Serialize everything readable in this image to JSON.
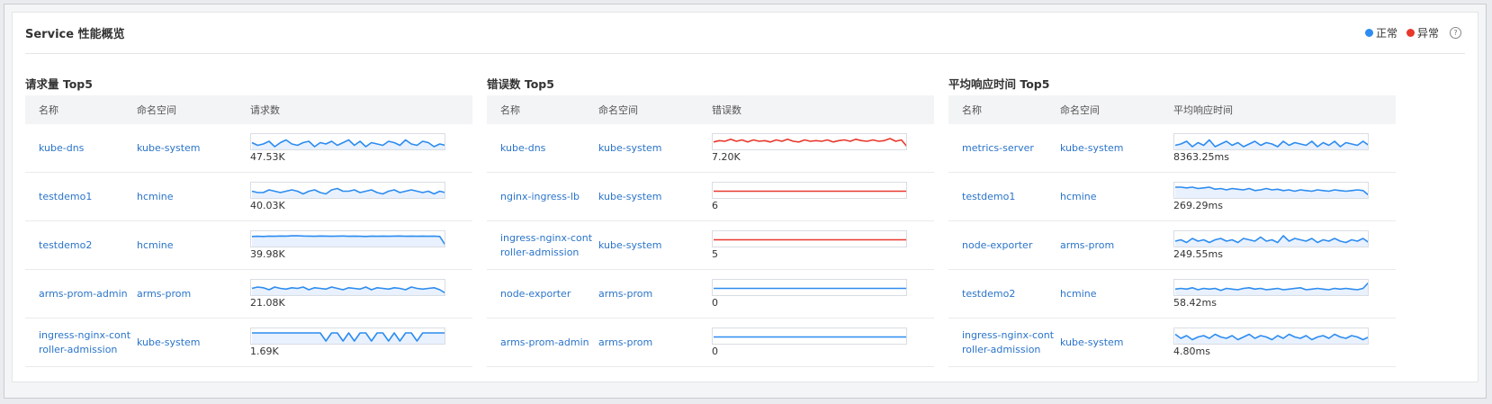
{
  "card": {
    "title": "Service 性能概览"
  },
  "legend": {
    "normal": "正常",
    "abnormal": "异常",
    "normal_color": "#2d8cf0",
    "abnormal_color": "#e8382c",
    "help_icon": "question-circle-icon"
  },
  "panels": [
    {
      "title": "请求量 Top5",
      "headers": [
        "名称",
        "命名空间",
        "请求数"
      ],
      "color": "#2d8cf0",
      "fill": "#e8f1fd",
      "rows": [
        {
          "name": "kube-dns",
          "ns": "kube-system",
          "value": "47.53K",
          "series": [
            0.5,
            0.3,
            0.4,
            0.6,
            0.2,
            0.5,
            0.7,
            0.4,
            0.3,
            0.5,
            0.6,
            0.2,
            0.5,
            0.4,
            0.6,
            0.3,
            0.5,
            0.7,
            0.3,
            0.6,
            0.2,
            0.5,
            0.4,
            0.3,
            0.6,
            0.5,
            0.3,
            0.7,
            0.4,
            0.3,
            0.6,
            0.5,
            0.2,
            0.4,
            0.3
          ]
        },
        {
          "name": "testdemo1",
          "ns": "hcmine",
          "value": "40.03K",
          "series": [
            0.5,
            0.4,
            0.4,
            0.6,
            0.5,
            0.4,
            0.5,
            0.6,
            0.5,
            0.3,
            0.5,
            0.6,
            0.4,
            0.3,
            0.6,
            0.7,
            0.5,
            0.5,
            0.6,
            0.4,
            0.5,
            0.6,
            0.4,
            0.3,
            0.5,
            0.6,
            0.4,
            0.5,
            0.6,
            0.5,
            0.4,
            0.5,
            0.3,
            0.5,
            0.4
          ]
        },
        {
          "name": "testdemo2",
          "ns": "hcmine",
          "value": "39.98K",
          "series": [
            0.75,
            0.76,
            0.75,
            0.77,
            0.76,
            0.78,
            0.77,
            0.79,
            0.8,
            0.78,
            0.77,
            0.76,
            0.78,
            0.77,
            0.76,
            0.77,
            0.78,
            0.76,
            0.77,
            0.76,
            0.75,
            0.77,
            0.76,
            0.77,
            0.76,
            0.77,
            0.78,
            0.76,
            0.77,
            0.76,
            0.77,
            0.76,
            0.77,
            0.75,
            0.1
          ]
        },
        {
          "name": "arms-prom-admin",
          "ns": "arms-prom",
          "value": "21.08K",
          "series": [
            0.5,
            0.6,
            0.55,
            0.4,
            0.6,
            0.5,
            0.45,
            0.55,
            0.5,
            0.6,
            0.4,
            0.55,
            0.5,
            0.45,
            0.6,
            0.5,
            0.4,
            0.55,
            0.5,
            0.45,
            0.6,
            0.4,
            0.55,
            0.5,
            0.45,
            0.55,
            0.5,
            0.4,
            0.6,
            0.5,
            0.45,
            0.5,
            0.55,
            0.4,
            0.15
          ]
        },
        {
          "name": "ingress-nginx-controller-admission",
          "ns": "kube-system",
          "value": "1.69K",
          "series": [
            0.8,
            0.8,
            0.8,
            0.8,
            0.8,
            0.8,
            0.8,
            0.8,
            0.8,
            0.8,
            0.8,
            0.8,
            0.8,
            0.2,
            0.8,
            0.8,
            0.2,
            0.8,
            0.2,
            0.8,
            0.8,
            0.2,
            0.8,
            0.8,
            0.2,
            0.8,
            0.2,
            0.8,
            0.8,
            0.2,
            0.8,
            0.8,
            0.8,
            0.8,
            0.8
          ]
        }
      ]
    },
    {
      "title": "错误数 Top5",
      "headers": [
        "名称",
        "命名空间",
        "错误数"
      ],
      "color": "#e8382c",
      "fill": "#ffffff",
      "rows": [
        {
          "name": "kube-dns",
          "ns": "kube-system",
          "value": "7.20K",
          "series": [
            0.55,
            0.65,
            0.6,
            0.75,
            0.6,
            0.7,
            0.55,
            0.7,
            0.6,
            0.65,
            0.55,
            0.7,
            0.6,
            0.75,
            0.6,
            0.55,
            0.7,
            0.6,
            0.65,
            0.6,
            0.7,
            0.55,
            0.65,
            0.7,
            0.6,
            0.75,
            0.65,
            0.6,
            0.7,
            0.6,
            0.65,
            0.8,
            0.6,
            0.7,
            0.2
          ]
        },
        {
          "name": "nginx-ingress-lb",
          "ns": "kube-system",
          "value": "6",
          "series": [
            0.5,
            0.5,
            0.5,
            0.5,
            0.5,
            0.5,
            0.5,
            0.5,
            0.5,
            0.5,
            0.5,
            0.5,
            0.5,
            0.5,
            0.5,
            0.5,
            0.5,
            0.5,
            0.5,
            0.5
          ]
        },
        {
          "name": "ingress-nginx-controller-admission",
          "ns": "kube-system",
          "value": "5",
          "series": [
            0.5,
            0.5,
            0.5,
            0.5,
            0.5,
            0.5,
            0.5,
            0.5,
            0.5,
            0.5,
            0.5,
            0.5,
            0.5,
            0.5,
            0.5,
            0.5,
            0.5,
            0.5,
            0.5,
            0.5
          ]
        },
        {
          "name": "node-exporter",
          "ns": "arms-prom",
          "value": "0",
          "series": [
            0.5,
            0.5,
            0.5,
            0.5,
            0.5,
            0.5,
            0.5,
            0.5,
            0.5,
            0.5,
            0.5,
            0.5,
            0.5,
            0.5,
            0.5,
            0.5,
            0.5,
            0.5,
            0.5,
            0.5
          ],
          "seriesColor": "#2d8cf0"
        },
        {
          "name": "arms-prom-admin",
          "ns": "arms-prom",
          "value": "0",
          "series": [
            0.5,
            0.5,
            0.5,
            0.5,
            0.5,
            0.5,
            0.5,
            0.5,
            0.5,
            0.5,
            0.5,
            0.5,
            0.5,
            0.5,
            0.5,
            0.5,
            0.5,
            0.5,
            0.5,
            0.5
          ],
          "seriesColor": "#2d8cf0"
        }
      ]
    },
    {
      "title": "平均响应时间 Top5",
      "headers": [
        "名称",
        "命名空间",
        "平均响应时间"
      ],
      "color": "#2d8cf0",
      "fill": "#e8f1fd",
      "rows": [
        {
          "name": "metrics-server",
          "ns": "kube-system",
          "value": "8363.25ms",
          "series": [
            0.3,
            0.4,
            0.6,
            0.2,
            0.5,
            0.3,
            0.7,
            0.2,
            0.4,
            0.6,
            0.3,
            0.5,
            0.2,
            0.4,
            0.6,
            0.3,
            0.5,
            0.4,
            0.2,
            0.6,
            0.3,
            0.5,
            0.4,
            0.3,
            0.6,
            0.2,
            0.5,
            0.3,
            0.6,
            0.2,
            0.5,
            0.4,
            0.3,
            0.6,
            0.3
          ]
        },
        {
          "name": "testdemo1",
          "ns": "hcmine",
          "value": "269.29ms",
          "series": [
            0.8,
            0.8,
            0.75,
            0.8,
            0.7,
            0.75,
            0.8,
            0.65,
            0.7,
            0.6,
            0.7,
            0.65,
            0.6,
            0.7,
            0.55,
            0.6,
            0.7,
            0.6,
            0.65,
            0.55,
            0.6,
            0.5,
            0.6,
            0.55,
            0.5,
            0.6,
            0.55,
            0.5,
            0.6,
            0.55,
            0.5,
            0.55,
            0.6,
            0.55,
            0.2
          ]
        },
        {
          "name": "node-exporter",
          "ns": "arms-prom",
          "value": "249.55ms",
          "series": [
            0.4,
            0.5,
            0.3,
            0.6,
            0.4,
            0.5,
            0.3,
            0.5,
            0.6,
            0.4,
            0.5,
            0.3,
            0.6,
            0.5,
            0.4,
            0.7,
            0.4,
            0.5,
            0.3,
            0.8,
            0.4,
            0.6,
            0.5,
            0.4,
            0.6,
            0.3,
            0.5,
            0.4,
            0.6,
            0.4,
            0.3,
            0.5,
            0.4,
            0.6,
            0.3
          ]
        },
        {
          "name": "testdemo2",
          "ns": "hcmine",
          "value": "58.42ms",
          "series": [
            0.45,
            0.5,
            0.45,
            0.55,
            0.4,
            0.5,
            0.45,
            0.5,
            0.35,
            0.5,
            0.45,
            0.4,
            0.5,
            0.55,
            0.45,
            0.5,
            0.4,
            0.45,
            0.5,
            0.4,
            0.45,
            0.5,
            0.55,
            0.4,
            0.45,
            0.5,
            0.45,
            0.4,
            0.5,
            0.45,
            0.5,
            0.45,
            0.4,
            0.5,
            0.95
          ]
        },
        {
          "name": "ingress-nginx-controller-admission",
          "ns": "kube-system",
          "value": "4.80ms",
          "series": [
            0.7,
            0.4,
            0.6,
            0.3,
            0.5,
            0.6,
            0.4,
            0.7,
            0.5,
            0.4,
            0.6,
            0.3,
            0.5,
            0.7,
            0.4,
            0.6,
            0.5,
            0.3,
            0.6,
            0.4,
            0.7,
            0.5,
            0.4,
            0.6,
            0.3,
            0.5,
            0.6,
            0.4,
            0.7,
            0.5,
            0.4,
            0.6,
            0.5,
            0.3,
            0.5
          ]
        }
      ]
    }
  ]
}
